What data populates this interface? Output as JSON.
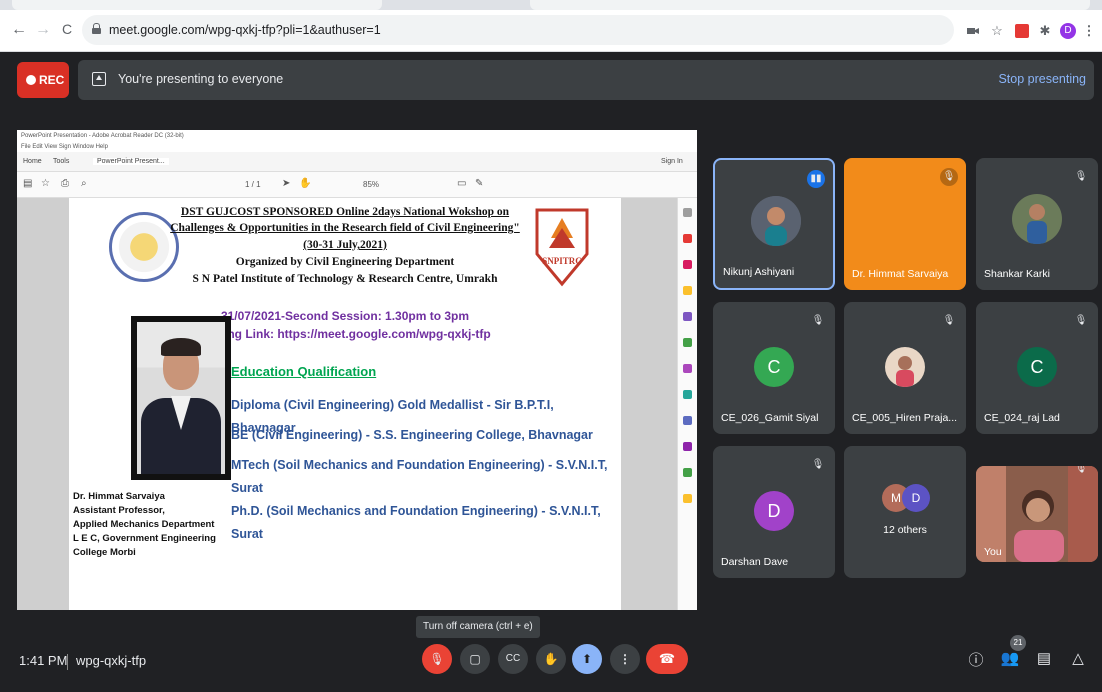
{
  "browser": {
    "url": "meet.google.com/wpg-qxkj-tfp?pli=1&authuser=1",
    "profile_initial": "D",
    "back_icon": "←",
    "forward_icon": "→",
    "reload_icon": "C"
  },
  "meeting_bar": {
    "rec_label": "REC",
    "presenting_text": "You're presenting to everyone",
    "stop_label": "Stop presenting"
  },
  "acrobat": {
    "window_title": "PowerPoint Presentation - Adobe Acrobat Reader DC (32-bit)",
    "menu": "File  Edit  View  Sign  Window  Help",
    "tab_home": "Home",
    "tab_tools": "Tools",
    "tab_doc": "PowerPoint Present...",
    "sign_in": "Sign In",
    "page_indicator": "1 / 1",
    "zoom": "85%"
  },
  "slide": {
    "title_line1": "DST GUJCOST SPONSORED Online 2days National Wokshop on",
    "title_line2": "Challenges & Opportunities in the Research field of Civil Engineering\"",
    "dates": "(30-31 July,2021)",
    "organized_by": "Organized by Civil Engineering Department",
    "institute": "S N Patel Institute of Technology & Research Centre, Umrakh",
    "logo_right_text": "SNPITRC",
    "session": "31/07/2021-Second Session: 1.30pm to 3pm",
    "joining_link": "Joining Link: https://meet.google.com/wpg-qxkj-tfp",
    "edu_title": "Education Qualification",
    "edu_items": [
      "Diploma (Civil Engineering) Gold Medallist - Sir B.P.T.I, Bhavnagar",
      "BE (Civil Engineering) - S.S. Engineering College, Bhavnagar",
      "MTech (Soil Mechanics and Foundation Engineering) - S.V.N.I.T, Surat",
      "Ph.D. (Soil Mechanics and Foundation Engineering) - S.V.N.I.T, Surat"
    ],
    "profile_lines": [
      "Dr. Himmat Sarvaiya",
      "Assistant Professor,",
      "Applied Mechanics Department",
      "L E C, Government Engineering",
      "College Morbi"
    ]
  },
  "participants": [
    {
      "name": "Nikunj Ashiyani",
      "type": "photo",
      "speaking": true
    },
    {
      "name": "Dr. Himmat Sarvaiya",
      "type": "none",
      "muted": true,
      "color": "#f28b1a"
    },
    {
      "name": "Shankar Karki",
      "type": "photo",
      "muted": true
    },
    {
      "name": "CE_026_Gamit Siyal",
      "type": "avatar",
      "initial": "C",
      "color": "#34a853",
      "muted": true
    },
    {
      "name": "CE_005_Hiren Praja...",
      "type": "photo",
      "muted": true
    },
    {
      "name": "CE_024_raj Lad",
      "type": "avatar",
      "initial": "C",
      "color": "#0b6b4a",
      "muted": true
    },
    {
      "name": "Darshan Dave",
      "type": "avatar",
      "initial": "D",
      "color": "#a142c9",
      "muted": true
    },
    {
      "name": "12 others",
      "type": "group",
      "initials": [
        "M",
        "D"
      ],
      "colors": [
        "#b36c5a",
        "#5c53c4"
      ]
    },
    {
      "name": "You",
      "type": "video",
      "muted": true
    }
  ],
  "bottom": {
    "time": "1:41 PM",
    "meeting_code": "wpg-qxkj-tfp",
    "tooltip": "Turn off camera (ctrl + e)",
    "participant_count": "21"
  }
}
